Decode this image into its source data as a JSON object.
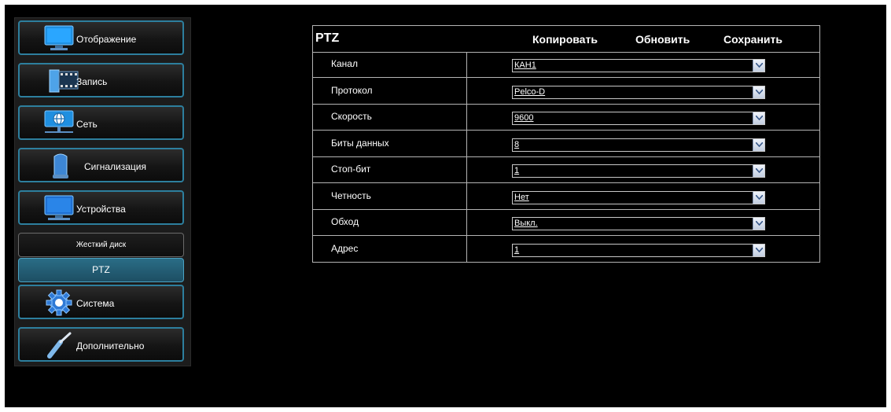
{
  "sidebar": {
    "menu": [
      {
        "label": "Отображение",
        "icon": "monitor-icon"
      },
      {
        "label": "Запись",
        "icon": "film-record-icon"
      },
      {
        "label": "Сеть",
        "icon": "network-globe-icon"
      },
      {
        "label": "Сигнализация",
        "icon": "alarm-siren-icon"
      },
      {
        "label": "Устройства",
        "icon": "device-monitor-icon"
      }
    ],
    "submenu": [
      {
        "label": "Жесткий диск",
        "active": false
      },
      {
        "label": "PTZ",
        "active": true
      }
    ],
    "menu_bottom": [
      {
        "label": "Система",
        "icon": "gear-icon"
      },
      {
        "label": "Дополнительно",
        "icon": "screwdriver-icon"
      }
    ]
  },
  "panel": {
    "title": "PTZ",
    "actions": {
      "copy": "Копировать",
      "refresh": "Обновить",
      "save": "Сохранить"
    },
    "rows": [
      {
        "label": "Канал",
        "value": "КАН1"
      },
      {
        "label": "Протокол",
        "value": "Pelco-D"
      },
      {
        "label": "Скорость",
        "value": "9600"
      },
      {
        "label": "Биты данных",
        "value": "8"
      },
      {
        "label": "Стоп-бит",
        "value": "1"
      },
      {
        "label": "Четность",
        "value": "Нет"
      },
      {
        "label": "Обход",
        "value": "Выкл."
      },
      {
        "label": "Адрес",
        "value": "1"
      }
    ]
  },
  "colors": {
    "background": "#000000",
    "accent": "#2d7f9e",
    "active_tab": "#2a6d86",
    "text": "#ffffff"
  }
}
